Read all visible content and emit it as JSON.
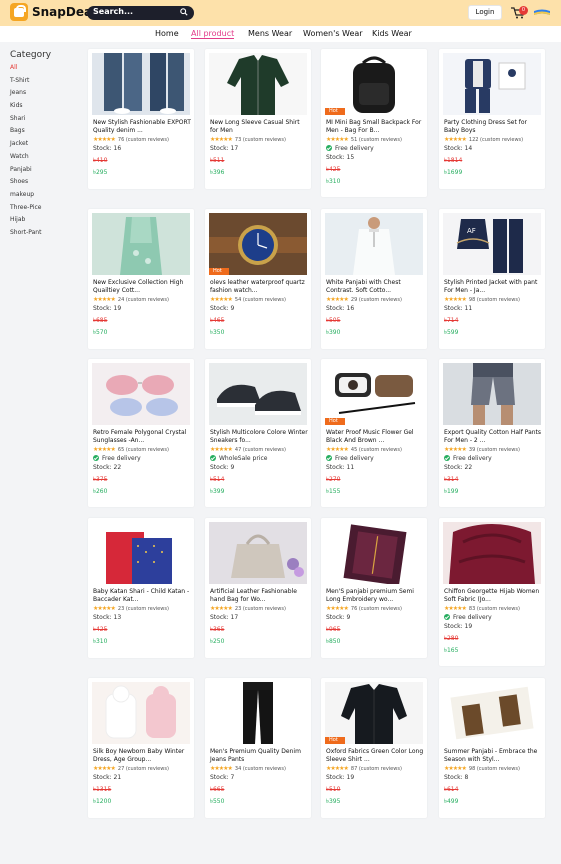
{
  "header": {
    "brand": "SnapDeal",
    "search_placeholder": "Search...",
    "login": "Login",
    "cart_count": "0"
  },
  "nav": [
    "Home",
    "All product",
    "Mens Wear",
    "Women's Wear",
    "Kids Wear"
  ],
  "sidebar": {
    "title": "Category",
    "items": [
      "All",
      "T-Shirt",
      "Jeans",
      "Kids",
      "Shari",
      "Bags",
      "Jacket",
      "Watch",
      "Panjabi",
      "Shoes",
      "makeup",
      "Three-Pice",
      "Hijab",
      "Short-Pant"
    ]
  },
  "products": [
    {
      "title": "New Stylish Fashionable EXPORT Quality denim ...",
      "reviews": "76 (custom reviews)",
      "stock": "Stock: 16",
      "old": "৳410",
      "price": "৳295",
      "hot": "",
      "delivery": "",
      "image": "jeans"
    },
    {
      "title": "New Long Sleeve Casual Shirt for Men",
      "reviews": "73 (custom reviews)",
      "stock": "Stock: 17",
      "old": "৳511",
      "price": "৳396",
      "hot": "",
      "delivery": "",
      "image": "shirt-green"
    },
    {
      "title": "MI Mini Bag Small Backpack For Men - Bag For B...",
      "reviews": "51 (custom reviews)",
      "stock": "Stock: 15",
      "old": "৳425",
      "price": "৳310",
      "hot": "Hot",
      "delivery": "Free delivery",
      "image": "backpack"
    },
    {
      "title": "Party Clothing Dress Set for Baby Boys",
      "reviews": "122 (custom reviews)",
      "stock": "Stock: 14",
      "old": "৳1814",
      "price": "৳1699",
      "hot": "",
      "delivery": "",
      "image": "boy-set"
    },
    {
      "title": "New Exclusive Collection High Quailtiey Cott...",
      "reviews": "24 (custom reviews)",
      "stock": "Stock: 19",
      "old": "৳685",
      "price": "৳570",
      "hot": "",
      "delivery": "",
      "image": "dress-green"
    },
    {
      "title": "olevs leather waterproof quartz fashion watch...",
      "reviews": "54 (custom reviews)",
      "stock": "Stock: 9",
      "old": "৳465",
      "price": "৳350",
      "hot": "Hot",
      "delivery": "",
      "image": "watch"
    },
    {
      "title": "White Panjabi with Chest Contrast. Soft Cotto...",
      "reviews": "29 (custom reviews)",
      "stock": "Stock: 16",
      "old": "৳505",
      "price": "৳390",
      "hot": "",
      "delivery": "",
      "image": "panjabi-white"
    },
    {
      "title": "Stylish Printed Jacket with pant For Men - Ja...",
      "reviews": "98 (custom reviews)",
      "stock": "Stock: 11",
      "old": "৳714",
      "price": "৳599",
      "hot": "",
      "delivery": "",
      "image": "tracksuit"
    },
    {
      "title": "Retro Female Polygonal Crystal Sunglasses -An...",
      "reviews": "65 (custom reviews)",
      "stock": "Stock: 22",
      "old": "৳375",
      "price": "৳260",
      "hot": "",
      "delivery": "Free delivery",
      "image": "sunglasses"
    },
    {
      "title": "Stylish Multicolore Colore Winter Sneakers fo...",
      "reviews": "47 (custom reviews)",
      "stock": "Stock: 9",
      "old": "৳514",
      "price": "৳399",
      "hot": "",
      "delivery": "WholeSale price",
      "image": "sneakers"
    },
    {
      "title": "Water Proof Music Flower Gel Black And Brown ...",
      "reviews": "45 (custom reviews)",
      "stock": "Stock: 11",
      "old": "৳270",
      "price": "৳155",
      "hot": "Hot",
      "delivery": "Free delivery",
      "image": "makeup"
    },
    {
      "title": "Export Quality Cotton Half Pants For Men - 2 ...",
      "reviews": "39 (custom reviews)",
      "stock": "Stock: 22",
      "old": "৳314",
      "price": "৳199",
      "hot": "",
      "delivery": "Free delivery",
      "image": "shorts"
    },
    {
      "title": "Baby Katan Shari - Child Katan - Baccader Kat...",
      "reviews": "23 (custom reviews)",
      "stock": "Stock: 13",
      "old": "৳425",
      "price": "৳310",
      "hot": "",
      "delivery": "",
      "image": "shari"
    },
    {
      "title": "Artificial Leather Fashionable hand Bag for Wo...",
      "reviews": "23 (custom reviews)",
      "stock": "Stock: 17",
      "old": "৳365",
      "price": "৳250",
      "hot": "",
      "delivery": "",
      "image": "handbag"
    },
    {
      "title": "Men'S panjabi premium Semi Long Embroidery wo...",
      "reviews": "76 (custom reviews)",
      "stock": "Stock: 9",
      "old": "৳965",
      "price": "৳850",
      "hot": "",
      "delivery": "",
      "image": "panjabi-box"
    },
    {
      "title": "Chiffon Georgette Hijab Women Soft Fabric (Jo...",
      "reviews": "83 (custom reviews)",
      "stock": "Stock: 19",
      "old": "৳280",
      "price": "৳165",
      "hot": "",
      "delivery": "Free delivery",
      "image": "hijab"
    },
    {
      "title": "Silk Boy Newborn Baby Winter Dress, Age Group...",
      "reviews": "27 (custom reviews)",
      "stock": "Stock: 21",
      "old": "৳1315",
      "price": "৳1200",
      "hot": "",
      "delivery": "",
      "image": "baby"
    },
    {
      "title": "Men's Premium Quality Denim Jeans Pants",
      "reviews": "34 (custom reviews)",
      "stock": "Stock: 7",
      "old": "৳665",
      "price": "৳550",
      "hot": "",
      "delivery": "",
      "image": "jeans-black"
    },
    {
      "title": "Oxford Fabrics Green Color Long Sleeve Shirt ...",
      "reviews": "87 (custom reviews)",
      "stock": "Stock: 19",
      "old": "৳510",
      "price": "৳395",
      "hot": "Hot",
      "delivery": "",
      "image": "shirt-black"
    },
    {
      "title": "Summer Panjabi - Embrace the Season with Styl...",
      "reviews": "98 (custom reviews)",
      "stock": "Stock: 8",
      "old": "৳614",
      "price": "৳499",
      "hot": "",
      "delivery": "",
      "image": "panjabi-print"
    }
  ]
}
